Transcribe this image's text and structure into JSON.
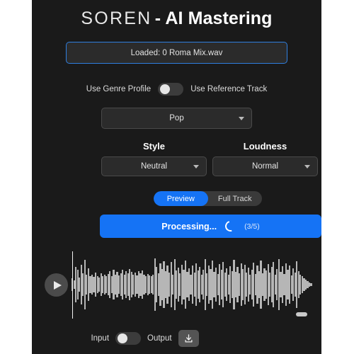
{
  "app": {
    "title_light": "SOREN",
    "title_bold": "- AI Mastering"
  },
  "loaded": {
    "text": "Loaded: 0 Roma Mix.wav"
  },
  "source_toggle": {
    "left_label": "Use Genre Profile",
    "right_label": "Use Reference Track",
    "state": "left",
    "knob_color": "#e6e6e6",
    "track_color": "#3c3c3c"
  },
  "genre": {
    "value": "Pop",
    "caret": "chevron-down-icon"
  },
  "style": {
    "label": "Style",
    "value": "Neutral"
  },
  "loudness": {
    "label": "Loudness",
    "value": "Normal"
  },
  "mode_segment": {
    "options": [
      "Preview",
      "Full Track"
    ],
    "selected": "Preview",
    "accent": "#1573f5"
  },
  "process": {
    "label": "Processing...",
    "count": "(3/5)",
    "spinner": "loading-spinner-icon",
    "accent": "#1573f5"
  },
  "waveform": {
    "play_icon": "play-icon",
    "playhead_position_pct": 0.5,
    "bar_color": "#b6b6b6",
    "bars": [
      18,
      12,
      52,
      44,
      20,
      58,
      34,
      72,
      30,
      48,
      26,
      30,
      22,
      36,
      26,
      20,
      34,
      26,
      30,
      24,
      32,
      40,
      26,
      44,
      30,
      38,
      28,
      34,
      44,
      30,
      40,
      34,
      46,
      38,
      30,
      36,
      28,
      40,
      34,
      42,
      30,
      26,
      32,
      28,
      24,
      30,
      78,
      52,
      34,
      62,
      46,
      68,
      40,
      56,
      36,
      66,
      30,
      74,
      42,
      50,
      34,
      58,
      44,
      70,
      38,
      48,
      30,
      56,
      36,
      62,
      42,
      52,
      30,
      44,
      76,
      34,
      56,
      46,
      70,
      38,
      50,
      32,
      60,
      44,
      66,
      36,
      48,
      30,
      54,
      40,
      72,
      38,
      52,
      34,
      62,
      46,
      58,
      36,
      50,
      30,
      44,
      64,
      32,
      56,
      40,
      70,
      34,
      48,
      42,
      60,
      36,
      52,
      66,
      30,
      46,
      74,
      38,
      54,
      32,
      62,
      44,
      56,
      28,
      48,
      36,
      68,
      40,
      30,
      24,
      18,
      14,
      10,
      7,
      5
    ],
    "handle": "resize-handle"
  },
  "bottom": {
    "left_label": "Input",
    "right_label": "Output",
    "state": "left",
    "download_icon": "download-icon"
  }
}
